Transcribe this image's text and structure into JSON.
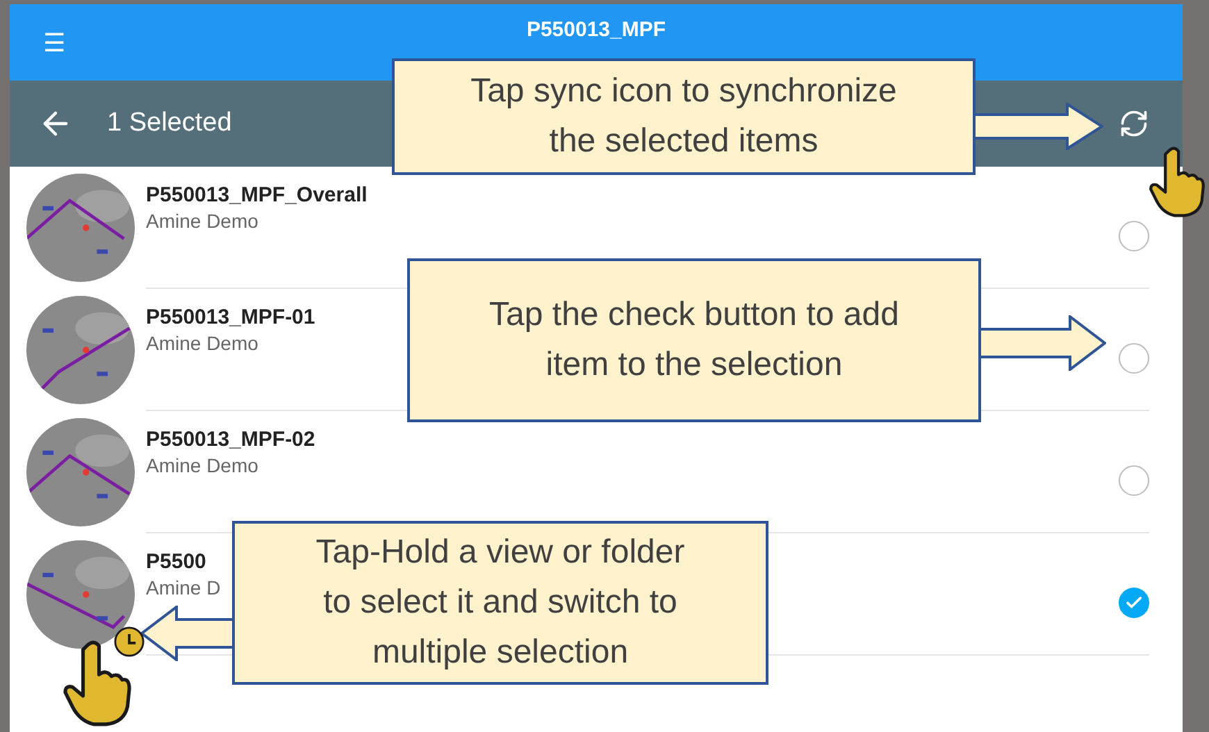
{
  "app_bar": {
    "menu_glyph": "☰",
    "title": "P550013_MPF"
  },
  "selection_bar": {
    "title": "1 Selected"
  },
  "items": [
    {
      "title": "P550013_MPF_Overall",
      "subtitle": "Amine Demo",
      "selected": false
    },
    {
      "title": "P550013_MPF-01",
      "subtitle": "Amine Demo",
      "selected": false
    },
    {
      "title": "P550013_MPF-02",
      "subtitle": "Amine Demo",
      "selected": false
    },
    {
      "title": "P5500",
      "subtitle": "Amine D",
      "selected": true
    }
  ],
  "callouts": [
    {
      "kind": "right",
      "lines": [
        "Tap sync icon to synchronize",
        "the selected items"
      ]
    },
    {
      "kind": "right",
      "lines": [
        "Tap the check button to add",
        "item to the selection"
      ]
    },
    {
      "kind": "left",
      "lines": [
        "Tap-Hold a view or folder",
        "to select it and switch to",
        "multiple selection"
      ]
    }
  ]
}
